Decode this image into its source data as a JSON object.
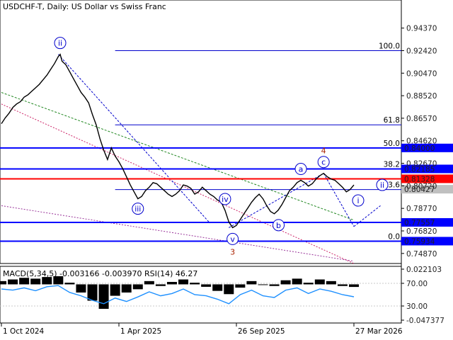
{
  "chart_data": {
    "type": "line",
    "title": "USDCHF-T, Daily:  US Dollar vs Swiss Franc",
    "subtitle": "MACD(5,34,5) -0.003166 -0.003970 RSI(14) 46.27",
    "x_tick_labels": [
      "1 Oct 2024",
      "1 Apr 2025",
      "26 Sep 2025",
      "27 Mar 2026"
    ],
    "price_axis": {
      "ylim": [
        0.74,
        0.968
      ],
      "tick_labels": [
        "0.94370",
        "0.92420",
        "0.90470",
        "0.88520",
        "0.86570",
        "0.84620",
        "0.82670",
        "0.80720",
        "0.78770",
        "0.76820",
        "0.74870"
      ]
    },
    "price_series": [
      [
        0,
        0.861
      ],
      [
        2,
        0.866
      ],
      [
        4,
        0.87
      ],
      [
        6,
        0.875
      ],
      [
        8,
        0.878
      ],
      [
        10,
        0.88
      ],
      [
        12,
        0.884
      ],
      [
        14,
        0.886
      ],
      [
        16,
        0.889
      ],
      [
        18,
        0.892
      ],
      [
        20,
        0.895
      ],
      [
        22,
        0.899
      ],
      [
        24,
        0.903
      ],
      [
        26,
        0.908
      ],
      [
        28,
        0.913
      ],
      [
        30,
        0.919
      ],
      [
        31,
        0.921
      ],
      [
        32,
        0.915
      ],
      [
        34,
        0.912
      ],
      [
        36,
        0.906
      ],
      [
        38,
        0.9
      ],
      [
        40,
        0.894
      ],
      [
        42,
        0.888
      ],
      [
        44,
        0.884
      ],
      [
        46,
        0.879
      ],
      [
        48,
        0.869
      ],
      [
        50,
        0.86
      ],
      [
        52,
        0.848
      ],
      [
        54,
        0.838
      ],
      [
        56,
        0.83
      ],
      [
        58,
        0.84
      ],
      [
        60,
        0.833
      ],
      [
        62,
        0.828
      ],
      [
        64,
        0.822
      ],
      [
        66,
        0.815
      ],
      [
        68,
        0.808
      ],
      [
        70,
        0.802
      ],
      [
        72,
        0.796
      ],
      [
        74,
        0.798
      ],
      [
        76,
        0.803
      ],
      [
        78,
        0.806
      ],
      [
        80,
        0.81
      ],
      [
        82,
        0.809
      ],
      [
        84,
        0.806
      ],
      [
        86,
        0.803
      ],
      [
        88,
        0.8
      ],
      [
        90,
        0.798
      ],
      [
        92,
        0.8
      ],
      [
        94,
        0.803
      ],
      [
        96,
        0.808
      ],
      [
        98,
        0.807
      ],
      [
        100,
        0.805
      ],
      [
        102,
        0.8
      ],
      [
        104,
        0.802
      ],
      [
        106,
        0.806
      ],
      [
        108,
        0.803
      ],
      [
        110,
        0.8
      ],
      [
        112,
        0.798
      ],
      [
        114,
        0.795
      ],
      [
        116,
        0.793
      ],
      [
        118,
        0.786
      ],
      [
        120,
        0.776
      ],
      [
        122,
        0.771
      ],
      [
        124,
        0.773
      ],
      [
        126,
        0.778
      ],
      [
        128,
        0.783
      ],
      [
        130,
        0.788
      ],
      [
        132,
        0.793
      ],
      [
        134,
        0.797
      ],
      [
        136,
        0.8
      ],
      [
        138,
        0.796
      ],
      [
        140,
        0.79
      ],
      [
        142,
        0.785
      ],
      [
        144,
        0.783
      ],
      [
        146,
        0.786
      ],
      [
        148,
        0.791
      ],
      [
        150,
        0.797
      ],
      [
        152,
        0.803
      ],
      [
        154,
        0.806
      ],
      [
        156,
        0.81
      ],
      [
        158,
        0.812
      ],
      [
        160,
        0.81
      ],
      [
        162,
        0.807
      ],
      [
        164,
        0.809
      ],
      [
        166,
        0.813
      ],
      [
        168,
        0.816
      ],
      [
        170,
        0.818
      ],
      [
        172,
        0.815
      ],
      [
        174,
        0.813
      ],
      [
        176,
        0.812
      ],
      [
        178,
        0.809
      ],
      [
        180,
        0.806
      ],
      [
        182,
        0.802
      ],
      [
        184,
        0.804
      ],
      [
        186,
        0.808
      ]
    ],
    "ohlc_last": 0.80427,
    "levels": [
      {
        "price": 0.9242,
        "label": "100.0",
        "role": "fibonacci",
        "color": "#0000cc"
      },
      {
        "price": 0.86,
        "label": "61.8",
        "role": "fibonacci",
        "color": "#0000cc"
      },
      {
        "price": 0.84,
        "label": "50.0",
        "value_label": "0.84000",
        "role": "target",
        "color": "#0000ff"
      },
      {
        "price": 0.82185,
        "label": "38.2",
        "value_label": "0.82185",
        "role": "resistance",
        "color": "#0000ff"
      },
      {
        "price": 0.81328,
        "value_label": "0.81328",
        "role": "pivot",
        "color": "#ff0000"
      },
      {
        "price": 0.80427,
        "value_label": "0.80427",
        "role": "last-price",
        "color": "#c0c0c0"
      },
      {
        "price": 0.804,
        "label": "23.6",
        "role": "fibonacci",
        "color": "#0000cc"
      },
      {
        "price": 0.77557,
        "value_label": "0.77557",
        "role": "support",
        "color": "#0000ff"
      },
      {
        "price": 0.75934,
        "label": "0.0",
        "value_label": "0.75934",
        "role": "support",
        "color": "#0000ff"
      }
    ],
    "wave_labels": [
      {
        "text": "ii",
        "at": [
          31,
          0.921
        ],
        "color": "#0000cc",
        "circled": true
      },
      {
        "text": "iii",
        "at": [
          72,
          0.796
        ],
        "color": "#0000cc",
        "circled": true
      },
      {
        "text": "iv",
        "at": [
          118,
          0.786
        ],
        "color": "#0000cc",
        "circled": true
      },
      {
        "text": "v",
        "at": [
          122,
          0.771
        ],
        "color": "#0000cc",
        "circled": true
      },
      {
        "text": "3",
        "at": [
          122,
          0.771
        ],
        "color": "#aa2200",
        "circled": false
      },
      {
        "text": "a",
        "at": [
          158,
          0.812
        ],
        "color": "#0000cc",
        "circled": true
      },
      {
        "text": "b",
        "at": [
          144,
          0.783
        ],
        "color": "#0000cc",
        "circled": true
      },
      {
        "text": "c",
        "at": [
          170,
          0.818
        ],
        "color": "#0000cc",
        "circled": true
      },
      {
        "text": "4",
        "at": [
          170,
          0.818
        ],
        "color": "#aa2200",
        "circled": false
      },
      {
        "text": "ii",
        "at": [
          186,
          0.808
        ],
        "color": "#0000cc",
        "circled": true
      },
      {
        "text": "i",
        "at": [
          186,
          0.808
        ],
        "color": "#0000cc",
        "circled": true
      }
    ],
    "indicator": {
      "name": "MACD(5,34,5) -0.003166 -0.003970 RSI(14) 46.27",
      "tick_labels": [
        "0.022103",
        "70.00",
        "30.00",
        "-0.047377"
      ],
      "ylim": [
        -0.047377,
        0.022103
      ],
      "rsi_series": [
        [
          0,
          60
        ],
        [
          6,
          58
        ],
        [
          12,
          62
        ],
        [
          18,
          57
        ],
        [
          24,
          64
        ],
        [
          30,
          66
        ],
        [
          36,
          54
        ],
        [
          42,
          48
        ],
        [
          48,
          40
        ],
        [
          54,
          34
        ],
        [
          60,
          44
        ],
        [
          66,
          38
        ],
        [
          72,
          46
        ],
        [
          78,
          55
        ],
        [
          84,
          48
        ],
        [
          90,
          52
        ],
        [
          96,
          60
        ],
        [
          102,
          50
        ],
        [
          108,
          48
        ],
        [
          114,
          42
        ],
        [
          120,
          34
        ],
        [
          126,
          50
        ],
        [
          132,
          58
        ],
        [
          138,
          48
        ],
        [
          144,
          45
        ],
        [
          150,
          58
        ],
        [
          156,
          62
        ],
        [
          162,
          52
        ],
        [
          168,
          60
        ],
        [
          174,
          56
        ],
        [
          180,
          50
        ],
        [
          186,
          46.27
        ]
      ],
      "macd_hist": [
        [
          0,
          0.004
        ],
        [
          6,
          0.006
        ],
        [
          12,
          0.008
        ],
        [
          18,
          0.007
        ],
        [
          24,
          0.009
        ],
        [
          30,
          0.01
        ],
        [
          36,
          0.002
        ],
        [
          42,
          -0.01
        ],
        [
          48,
          -0.02
        ],
        [
          54,
          -0.03
        ],
        [
          60,
          -0.014
        ],
        [
          66,
          -0.01
        ],
        [
          72,
          -0.006
        ],
        [
          78,
          0.004
        ],
        [
          84,
          -0.002
        ],
        [
          90,
          0.003
        ],
        [
          96,
          0.006
        ],
        [
          102,
          0.002
        ],
        [
          108,
          -0.003
        ],
        [
          114,
          -0.008
        ],
        [
          120,
          -0.012
        ],
        [
          126,
          -0.004
        ],
        [
          132,
          0.004
        ],
        [
          138,
          0.0
        ],
        [
          144,
          -0.002
        ],
        [
          150,
          0.005
        ],
        [
          156,
          0.007
        ],
        [
          162,
          0.002
        ],
        [
          168,
          0.006
        ],
        [
          174,
          0.004
        ],
        [
          180,
          -0.002
        ],
        [
          186,
          -0.003166
        ]
      ]
    }
  },
  "colors": {
    "background": "#ffffff",
    "price_line": "#000000",
    "fib": "#0000cc",
    "strong_level": "#0000ff",
    "pivot": "#ff0000",
    "wave_blue": "#0000cc",
    "wave_red": "#aa2200",
    "rsi": "#1e90ff",
    "macd_hist": "#000000",
    "grid": "#c8c8c8"
  }
}
